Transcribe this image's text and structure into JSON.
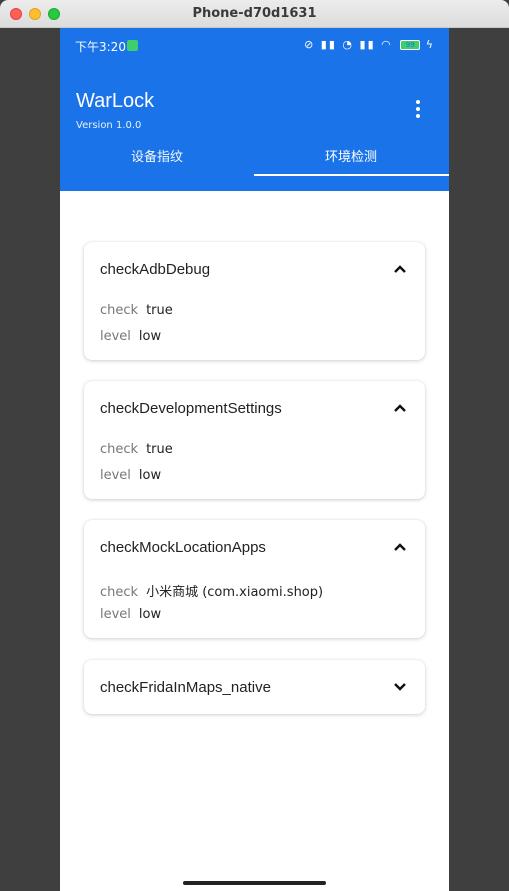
{
  "window": {
    "title": "Phone-d70d1631"
  },
  "status_bar": {
    "time": "下午3:20",
    "battery": "99"
  },
  "app": {
    "title": "WarLock",
    "version": "Version 1.0.0"
  },
  "tabs": [
    {
      "label": "设备指纹",
      "selected": false
    },
    {
      "label": "环境检测",
      "selected": true
    }
  ],
  "cards": [
    {
      "title": "checkAdbDebug",
      "expanded": true,
      "rows": [
        {
          "key": "check",
          "value": "true"
        },
        {
          "key": "level",
          "value": "low"
        }
      ]
    },
    {
      "title": "checkDevelopmentSettings",
      "expanded": true,
      "rows": [
        {
          "key": "check",
          "value": "true"
        },
        {
          "key": "level",
          "value": "low"
        }
      ]
    },
    {
      "title": "checkMockLocationApps",
      "expanded": true,
      "rows": [
        {
          "key": "check",
          "value": "小米商城 (com.xiaomi.shop)"
        },
        {
          "key": "level",
          "value": "low"
        }
      ]
    },
    {
      "title": "checkFridaInMaps_native",
      "expanded": false,
      "rows": []
    }
  ],
  "colors": {
    "primary": "#1a73e8",
    "surface": "#ffffff"
  }
}
